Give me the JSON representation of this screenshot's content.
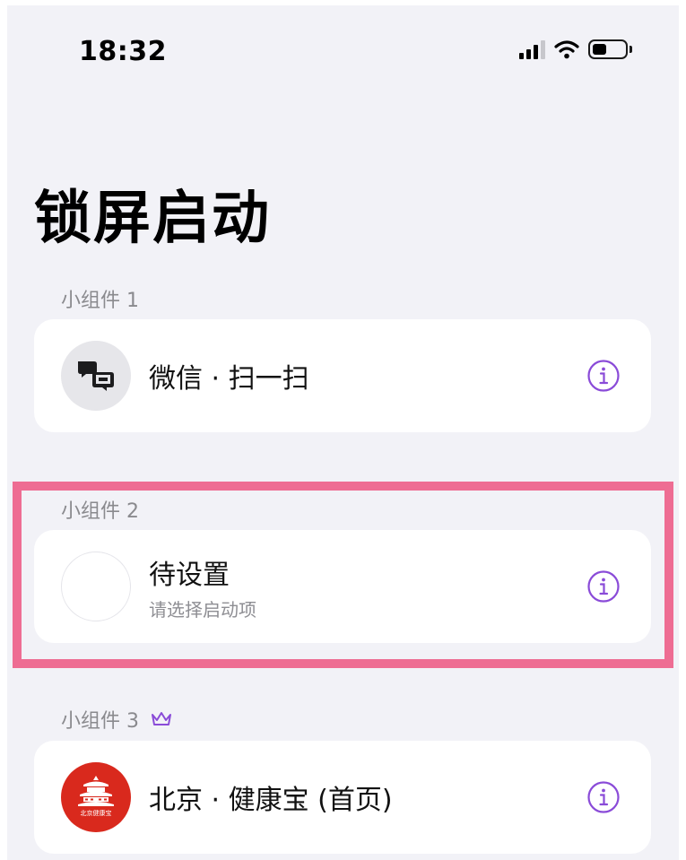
{
  "status_bar": {
    "time": "18:32",
    "battery_level": 0.45
  },
  "page": {
    "title": "锁屏启动"
  },
  "widgets": [
    {
      "label": "小组件 1",
      "title": "微信 · 扫一扫",
      "subtitle": "",
      "icon": "wechat-scan-icon",
      "premium": false
    },
    {
      "label": "小组件 2",
      "title": "待设置",
      "subtitle": "请选择启动项",
      "icon": "empty-slot-icon",
      "premium": false
    },
    {
      "label": "小组件 3",
      "title": "北京 · 健康宝 (首页)",
      "subtitle": "",
      "icon": "beijing-health-kit-icon",
      "icon_caption": "北京健康宝",
      "premium": true
    }
  ],
  "colors": {
    "accent": "#8a4bd8",
    "highlight": "#ee6d93",
    "background": "#f2f2f7",
    "health_red": "#d9291d"
  }
}
